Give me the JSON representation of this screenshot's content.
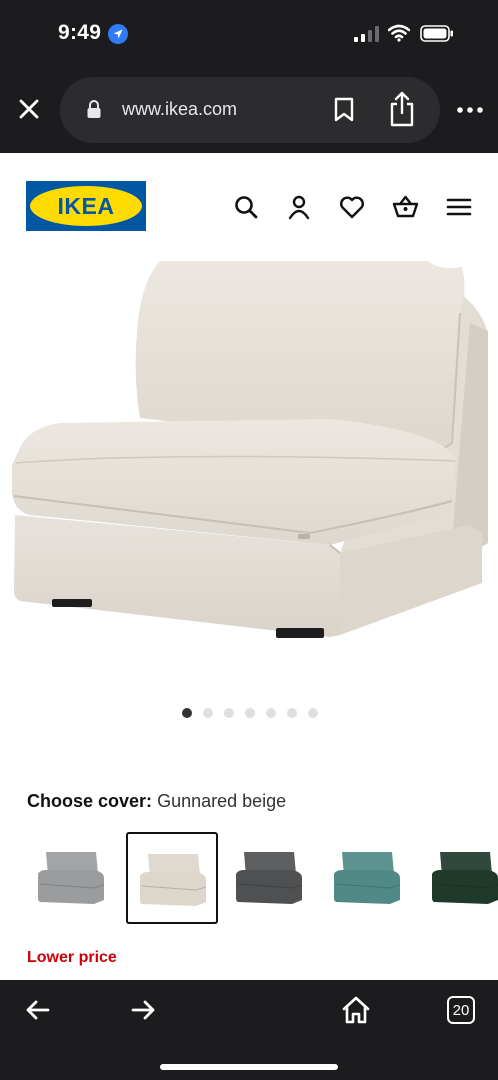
{
  "status_bar": {
    "time": "9:49"
  },
  "browser": {
    "url": "www.ikea.com",
    "tab_count": "20"
  },
  "brand": {
    "logo_text": "IKEA",
    "colors": {
      "blue": "#0058a3",
      "yellow": "#ffdb00"
    }
  },
  "header_icons": [
    "search-icon",
    "account-icon",
    "heart-icon",
    "basket-icon",
    "menu-icon"
  ],
  "gallery": {
    "image_count": 7,
    "active_index": 0
  },
  "cover": {
    "label": "Choose cover:",
    "value": "Gunnared beige",
    "swatches": [
      {
        "name": "grey",
        "color": "#9a9c9e"
      },
      {
        "name": "beige",
        "color": "#ddd6cb",
        "selected": true
      },
      {
        "name": "dark-grey",
        "color": "#4f5052"
      },
      {
        "name": "turquoise",
        "color": "#4f8a86"
      },
      {
        "name": "dark-green",
        "color": "#1f3a2b"
      }
    ]
  },
  "price_note": "Lower price"
}
